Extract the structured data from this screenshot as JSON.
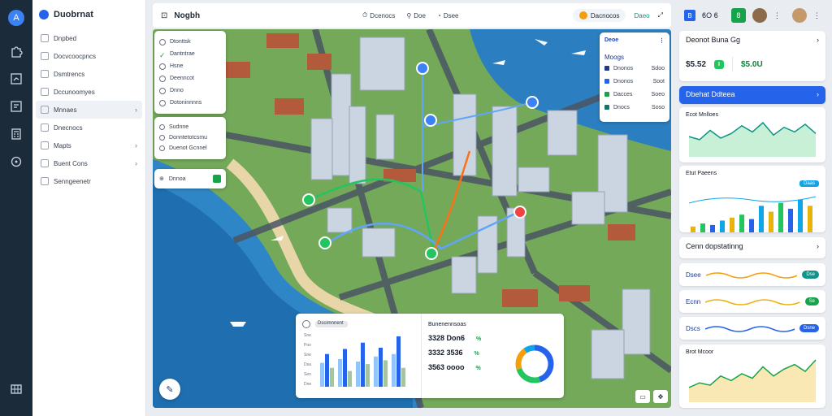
{
  "rail": {
    "logo": "A",
    "icons": [
      "puzzle-icon",
      "chart-icon",
      "image-icon",
      "calculator-icon",
      "compass-icon",
      "grid-icon"
    ]
  },
  "nav": {
    "brand": "Duobrnat",
    "items": [
      {
        "label": "Dnpbed",
        "chevron": false
      },
      {
        "label": "Docvcoocpncs",
        "chevron": false
      },
      {
        "label": "Dsmtrencs",
        "chevron": false
      },
      {
        "label": "Dccunoomyes",
        "chevron": false
      },
      {
        "label": "Mnnaes",
        "chevron": true
      },
      {
        "label": "Dnecnocs",
        "chevron": false
      },
      {
        "label": "Mapts",
        "chevron": true
      },
      {
        "label": "Buent Cons",
        "chevron": true
      },
      {
        "label": "Senngeenetr",
        "chevron": false
      }
    ]
  },
  "header": {
    "title": "Nogbh",
    "tabs": [
      "Dcenocs",
      "Doe",
      "Dsee"
    ],
    "pill": "Dacnocos",
    "right_link": "Daeo"
  },
  "map": {
    "layers": [
      "Dtonttsk",
      "Dantntrae",
      "Hsne",
      "Deenncot",
      "Dnno",
      "Dotoninnnns"
    ],
    "layers_checked": [
      false,
      true,
      false,
      false,
      false,
      false
    ],
    "layers2": [
      "Sudnne",
      "Donntetotcsmu",
      "Duenot Gcnnel"
    ],
    "layers3": "Dnnoa",
    "legend": {
      "title": "Deoe",
      "subtitle": "Moogs",
      "rows": [
        {
          "label": "Dnonos",
          "value": "Sdoo",
          "color": "#1e3a8a"
        },
        {
          "label": "Dnonos",
          "value": "Soot",
          "color": "#2563eb"
        },
        {
          "label": "Dacces",
          "value": "Soeo",
          "color": "#16a34a"
        },
        {
          "label": "Dnocs",
          "value": "Soso",
          "color": "#0f766e"
        }
      ]
    },
    "stats": {
      "header_label": "Dscimnnent",
      "y_ticks": [
        "Sne",
        "Poo",
        "Sne",
        "Dsa",
        "Sen",
        "Dne"
      ],
      "bars": [
        [
          38,
          52,
          30
        ],
        [
          44,
          60,
          25
        ],
        [
          40,
          70,
          36
        ],
        [
          48,
          62,
          42
        ],
        [
          52,
          80,
          30
        ]
      ],
      "right_title": "Bunenennsoas",
      "figures": [
        {
          "value": "3328 Don6",
          "delta": "%"
        },
        {
          "value": "3332 3536",
          "delta": "%"
        },
        {
          "value": "3563 oooo",
          "delta": "%"
        }
      ],
      "donut": [
        45,
        25,
        20,
        10
      ]
    }
  },
  "right": {
    "head": {
      "brand": "B",
      "label": "ϐO ϐ",
      "avatar_b": "8"
    },
    "balance": {
      "title": "Deonot Buna Gg",
      "left": "$5.52",
      "tag": "I",
      "right": "$5.0U"
    },
    "blue_bar": "Dbehat Ddteea",
    "chart1": {
      "title": "Ecot Mnlloes",
      "series": [
        22,
        18,
        30,
        20,
        26,
        36,
        28,
        40,
        24,
        34,
        28,
        38,
        26
      ]
    },
    "chart2": {
      "title": "Etut Paeens",
      "badge": "Daas",
      "bars": [
        4,
        6,
        5,
        8,
        10,
        12,
        9,
        18,
        14,
        20,
        16,
        22,
        18
      ]
    },
    "section": "Cenn dopstatinng",
    "minis": [
      {
        "label": "Dsee",
        "tag": "Dse",
        "tag_color": "#0e9488"
      },
      {
        "label": "Ecnn",
        "tag": "Se",
        "tag_color": "#16a34a"
      },
      {
        "label": "Dscs",
        "tag": "Dsne",
        "tag_color": "#2563eb"
      }
    ],
    "chart3": {
      "title": "Brot Mcoor",
      "series": [
        10,
        14,
        12,
        20,
        16,
        22,
        18,
        28,
        20,
        26,
        30,
        24,
        34
      ]
    }
  }
}
